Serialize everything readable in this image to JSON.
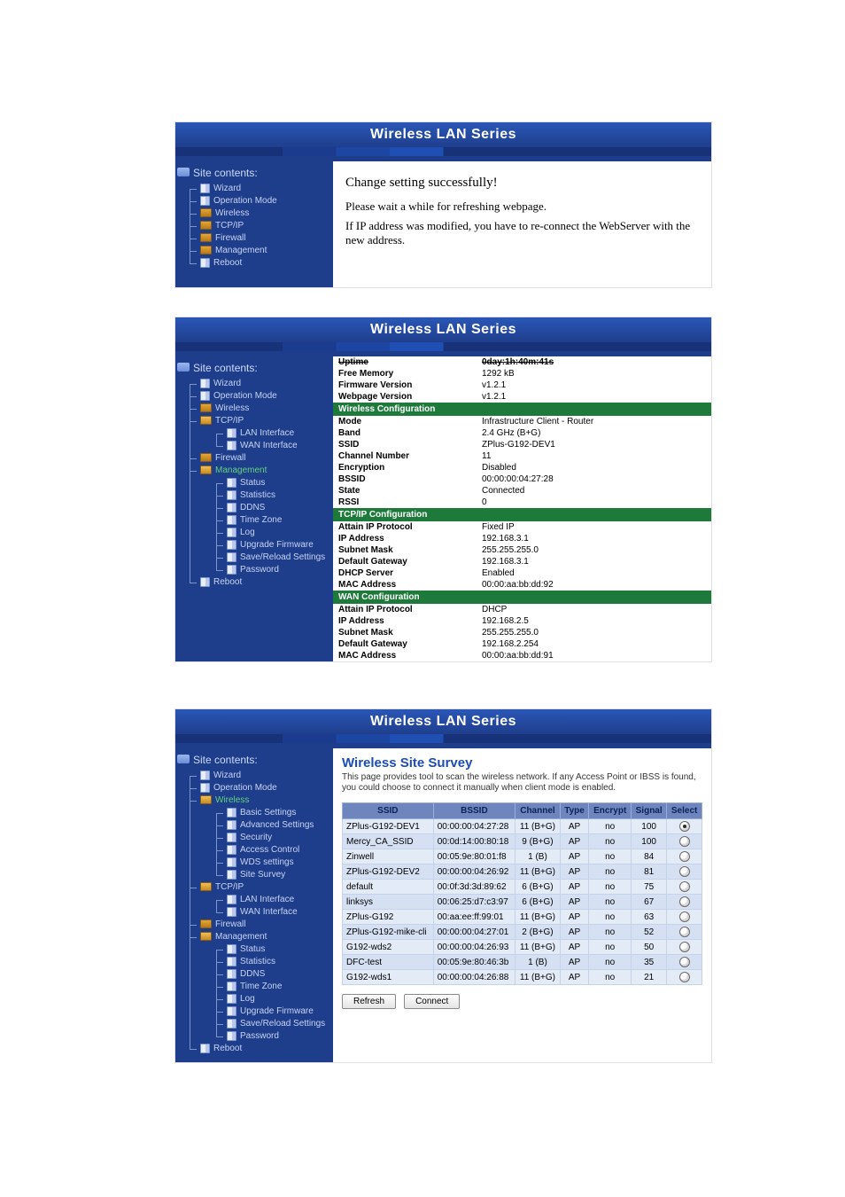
{
  "header_title": "Wireless LAN Series",
  "sidebar_title": "Site contents:",
  "panel1": {
    "sidebar": [
      {
        "label": "Wizard",
        "icon": "page"
      },
      {
        "label": "Operation Mode",
        "icon": "page"
      },
      {
        "label": "Wireless",
        "icon": "folder"
      },
      {
        "label": "TCP/IP",
        "icon": "folder"
      },
      {
        "label": "Firewall",
        "icon": "folder"
      },
      {
        "label": "Management",
        "icon": "folder"
      },
      {
        "label": "Reboot",
        "icon": "page"
      }
    ],
    "msg_h1": "Change setting successfully!",
    "msg_p1": "Please wait a while for refreshing webpage.",
    "msg_p2": "If IP address was modified, you have to re-connect the WebServer with the new address."
  },
  "panel2": {
    "sidebar": [
      {
        "label": "Wizard",
        "icon": "page"
      },
      {
        "label": "Operation Mode",
        "icon": "page"
      },
      {
        "label": "Wireless",
        "icon": "folder"
      },
      {
        "label": "TCP/IP",
        "icon": "folder-open",
        "children": [
          {
            "label": "LAN Interface",
            "icon": "page"
          },
          {
            "label": "WAN Interface",
            "icon": "page"
          }
        ]
      },
      {
        "label": "Firewall",
        "icon": "folder"
      },
      {
        "label": "Management",
        "icon": "folder-open",
        "hl": true,
        "children": [
          {
            "label": "Status",
            "icon": "page"
          },
          {
            "label": "Statistics",
            "icon": "page"
          },
          {
            "label": "DDNS",
            "icon": "page"
          },
          {
            "label": "Time Zone",
            "icon": "page"
          },
          {
            "label": "Log",
            "icon": "page"
          },
          {
            "label": "Upgrade Firmware",
            "icon": "page"
          },
          {
            "label": "Save/Reload Settings",
            "icon": "page"
          },
          {
            "label": "Password",
            "icon": "page"
          }
        ]
      },
      {
        "label": "Reboot",
        "icon": "page"
      }
    ],
    "rows": [
      {
        "section": "",
        "k": "Uptime",
        "v": "0day:1h:40m:41s",
        "strike": true
      },
      {
        "k": "Free Memory",
        "v": "1292 kB"
      },
      {
        "k": "Firmware Version",
        "v": "v1.2.1"
      },
      {
        "k": "Webpage Version",
        "v": "v1.2.1"
      },
      {
        "section": "Wireless Configuration"
      },
      {
        "k": "Mode",
        "v": "Infrastructure Client - Router"
      },
      {
        "k": "Band",
        "v": "2.4 GHz (B+G)"
      },
      {
        "k": "SSID",
        "v": "ZPlus-G192-DEV1"
      },
      {
        "k": "Channel Number",
        "v": "11"
      },
      {
        "k": "Encryption",
        "v": "Disabled"
      },
      {
        "k": "BSSID",
        "v": "00:00:00:04:27:28"
      },
      {
        "k": "State",
        "v": "Connected"
      },
      {
        "k": "RSSI",
        "v": "0"
      },
      {
        "section": "TCP/IP Configuration"
      },
      {
        "k": "Attain IP Protocol",
        "v": "Fixed IP"
      },
      {
        "k": "IP Address",
        "v": "192.168.3.1"
      },
      {
        "k": "Subnet Mask",
        "v": "255.255.255.0"
      },
      {
        "k": "Default Gateway",
        "v": "192.168.3.1"
      },
      {
        "k": "DHCP Server",
        "v": "Enabled"
      },
      {
        "k": "MAC Address",
        "v": "00:00:aa:bb:dd:92"
      },
      {
        "section": "WAN Configuration"
      },
      {
        "k": "Attain IP Protocol",
        "v": "DHCP"
      },
      {
        "k": "IP Address",
        "v": "192.168.2.5"
      },
      {
        "k": "Subnet Mask",
        "v": "255.255.255.0"
      },
      {
        "k": "Default Gateway",
        "v": "192.168.2.254"
      },
      {
        "k": "MAC Address",
        "v": "00:00:aa:bb:dd:91"
      }
    ]
  },
  "panel3": {
    "sidebar": [
      {
        "label": "Wizard",
        "icon": "page"
      },
      {
        "label": "Operation Mode",
        "icon": "page"
      },
      {
        "label": "Wireless",
        "icon": "folder-open",
        "hl": true,
        "children": [
          {
            "label": "Basic Settings",
            "icon": "page"
          },
          {
            "label": "Advanced Settings",
            "icon": "page"
          },
          {
            "label": "Security",
            "icon": "page"
          },
          {
            "label": "Access Control",
            "icon": "page"
          },
          {
            "label": "WDS settings",
            "icon": "page"
          },
          {
            "label": "Site Survey",
            "icon": "page"
          }
        ]
      },
      {
        "label": "TCP/IP",
        "icon": "folder-open",
        "children": [
          {
            "label": "LAN Interface",
            "icon": "page"
          },
          {
            "label": "WAN Interface",
            "icon": "page"
          }
        ]
      },
      {
        "label": "Firewall",
        "icon": "folder"
      },
      {
        "label": "Management",
        "icon": "folder-open",
        "children": [
          {
            "label": "Status",
            "icon": "page"
          },
          {
            "label": "Statistics",
            "icon": "page"
          },
          {
            "label": "DDNS",
            "icon": "page"
          },
          {
            "label": "Time Zone",
            "icon": "page"
          },
          {
            "label": "Log",
            "icon": "page"
          },
          {
            "label": "Upgrade Firmware",
            "icon": "page"
          },
          {
            "label": "Save/Reload Settings",
            "icon": "page"
          },
          {
            "label": "Password",
            "icon": "page"
          }
        ]
      },
      {
        "label": "Reboot",
        "icon": "page"
      }
    ],
    "title": "Wireless Site Survey",
    "desc": "This page provides tool to scan the wireless network. If any Access Point or IBSS is found, you could choose to connect it manually when client mode is enabled.",
    "cols": [
      "SSID",
      "BSSID",
      "Channel",
      "Type",
      "Encrypt",
      "Signal",
      "Select"
    ],
    "scan": [
      {
        "ssid": "ZPlus-G192-DEV1",
        "bssid": "00:00:00:04:27:28",
        "ch": "11 (B+G)",
        "type": "AP",
        "enc": "no",
        "sig": "100",
        "sel": true
      },
      {
        "ssid": "Mercy_CA_SSID",
        "bssid": "00:0d:14:00:80:18",
        "ch": "9 (B+G)",
        "type": "AP",
        "enc": "no",
        "sig": "100"
      },
      {
        "ssid": "Zinwell",
        "bssid": "00:05:9e:80:01:f8",
        "ch": "1 (B)",
        "type": "AP",
        "enc": "no",
        "sig": "84"
      },
      {
        "ssid": "ZPlus-G192-DEV2",
        "bssid": "00:00:00:04:26:92",
        "ch": "11 (B+G)",
        "type": "AP",
        "enc": "no",
        "sig": "81"
      },
      {
        "ssid": "default",
        "bssid": "00:0f:3d:3d:89:62",
        "ch": "6 (B+G)",
        "type": "AP",
        "enc": "no",
        "sig": "75"
      },
      {
        "ssid": "linksys",
        "bssid": "00:06:25:d7:c3:97",
        "ch": "6 (B+G)",
        "type": "AP",
        "enc": "no",
        "sig": "67"
      },
      {
        "ssid": "ZPlus-G192",
        "bssid": "00:aa:ee:ff:99:01",
        "ch": "11 (B+G)",
        "type": "AP",
        "enc": "no",
        "sig": "63"
      },
      {
        "ssid": "ZPlus-G192-mike-cli",
        "bssid": "00:00:00:04:27:01",
        "ch": "2 (B+G)",
        "type": "AP",
        "enc": "no",
        "sig": "52"
      },
      {
        "ssid": "G192-wds2",
        "bssid": "00:00:00:04:26:93",
        "ch": "11 (B+G)",
        "type": "AP",
        "enc": "no",
        "sig": "50"
      },
      {
        "ssid": "DFC-test",
        "bssid": "00:05:9e:80:46:3b",
        "ch": "1 (B)",
        "type": "AP",
        "enc": "no",
        "sig": "35"
      },
      {
        "ssid": "G192-wds1",
        "bssid": "00:00:00:04:26:88",
        "ch": "11 (B+G)",
        "type": "AP",
        "enc": "no",
        "sig": "21"
      }
    ],
    "btn_refresh": "Refresh",
    "btn_connect": "Connect"
  }
}
